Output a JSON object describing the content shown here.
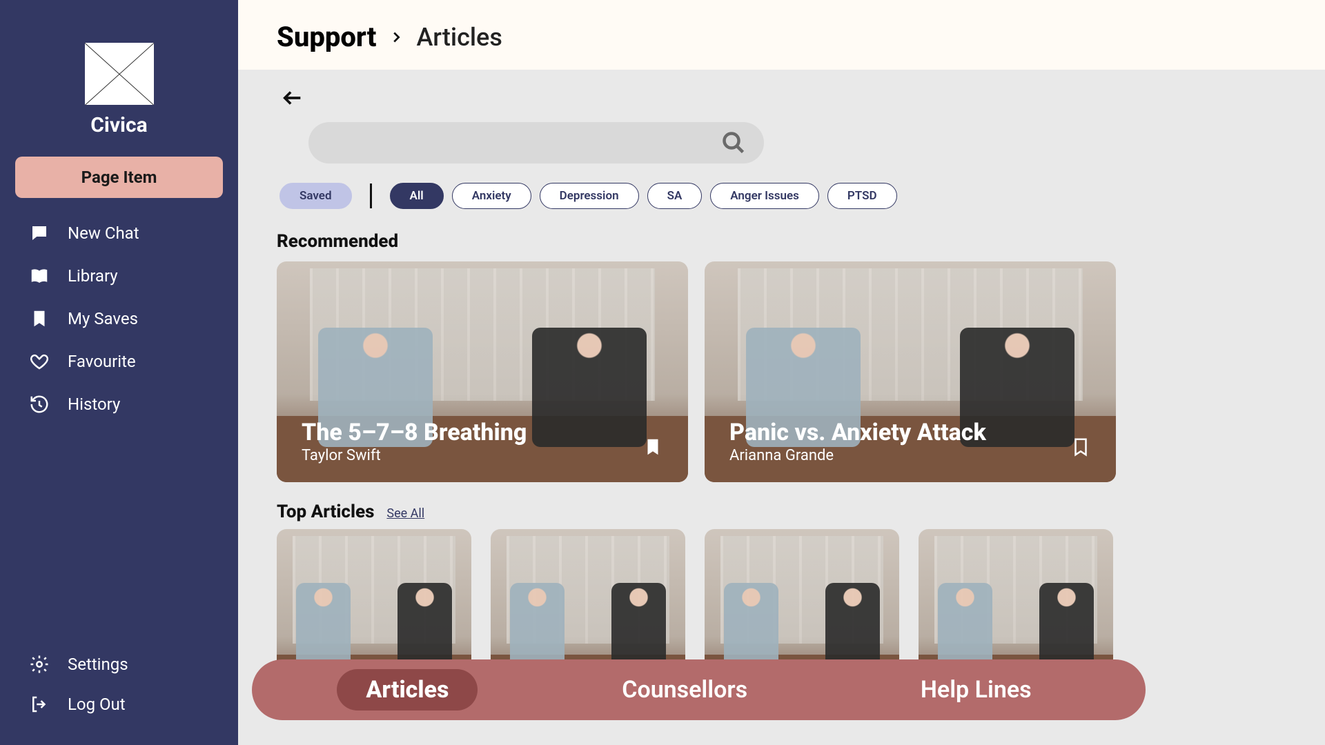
{
  "brand": {
    "name": "Civica"
  },
  "sidebar": {
    "pageItem": "Page Item",
    "items": [
      {
        "label": "New Chat"
      },
      {
        "label": "Library"
      },
      {
        "label": "My Saves"
      },
      {
        "label": "Favourite"
      },
      {
        "label": "History"
      }
    ],
    "bottom": [
      {
        "label": "Settings"
      },
      {
        "label": "Log Out"
      }
    ]
  },
  "breadcrumb": {
    "root": "Support",
    "current": "Articles"
  },
  "filters": {
    "saved": "Saved",
    "chips": [
      "All",
      "Anxiety",
      "Depression",
      "SA",
      "Anger Issues",
      "PTSD"
    ],
    "activeIndex": 0
  },
  "sections": {
    "recommended": "Recommended",
    "top": "Top Articles",
    "seeAll": "See All"
  },
  "recommended": [
    {
      "title": "The 5–7–8 Breathing",
      "author": "Taylor Swift",
      "saved": true
    },
    {
      "title": "Panic vs. Anxiety Attack",
      "author": "Arianna Grande",
      "saved": false
    }
  ],
  "tabs": {
    "items": [
      "Articles",
      "Counsellors",
      "Help Lines"
    ],
    "activeIndex": 0
  }
}
